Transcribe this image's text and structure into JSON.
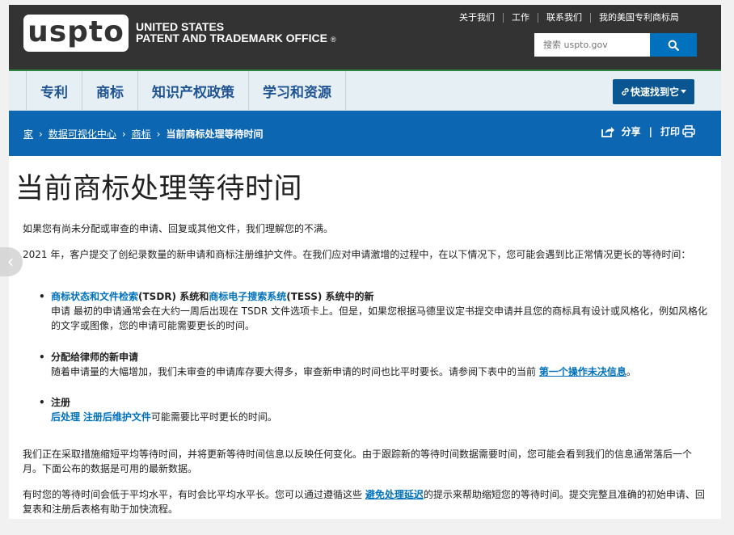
{
  "header": {
    "logo_text": "uspto",
    "agency_line1": "UNITED STATES",
    "agency_line2": "PATENT AND TRADEMARK OFFICE",
    "reg_mark": "®",
    "utility_links": [
      "关于我们",
      "工作",
      "联系我们",
      "我的美国专利商标局"
    ],
    "search_placeholder": "搜索 uspto.gov",
    "search_icon": "search-icon"
  },
  "nav": {
    "items": [
      "专利",
      "商标",
      "知识产权政策",
      "学习和资源"
    ],
    "quick_button": "快速找到它"
  },
  "breadcrumb": {
    "items": [
      "家",
      "数据可视化中心",
      "商标"
    ],
    "current": "当前商标处理等待时间",
    "share_label": "分享",
    "print_label": "打印"
  },
  "content": {
    "page_title": "当前商标处理等待时间",
    "intro": "如果您有尚未分配或审查的申请、回复或其他文件，我们理解您的不满。",
    "para2": "2021 年，客户提交了创纪录数量的新申请和商标注册维护文件。在我们应对申请激增的过程中，在以下情况下，您可能会遇到比正常情况更长的等待时间：",
    "bullet1": {
      "link1": "商标状态和文件检索",
      "text1": "(TSDR) 系统和",
      "link2": "商标电子搜索系统",
      "text2": "(TESS) 系统中的新",
      "body": "申请 最初的申请通常会在大约一周后出现在 TSDR 文件选项卡上。但是，如果您根据马德里议定书提交申请并且您的商标具有设计或风格化，例如风格化的文字或图像，您的申请可能需要更长的时间。"
    },
    "bullet2": {
      "heading": "分配给律师的新申请",
      "body": "随着申请量的大幅增加，我们未审查的申请库存要大得多，审查新申请的时间也比平时要长。请参阅下表中的当前",
      "link": "第一个操作未决信息",
      "end": "。"
    },
    "bullet3": {
      "heading": "注册",
      "link1": "后处理",
      "link2": "注册后维护文件",
      "body": "可能需要比平时更长的时间。"
    },
    "para3": "我们正在采取措施缩短平均等待时间，并将更新等待时间信息以反映任何变化。由于跟踪新的等待时间数据需要时间，您可能会看到我们的信息通常落后一个月。下面公布的数据是可用的最新数据。",
    "para4_start": "有时您的等待时间会低于平均水平，有时会比平均水平长。您可以通过遵循这些",
    "para4_link": "避免处理延迟",
    "para4_end": "的提示来帮助缩短您的等待时间。提交完整且准确的初始申请、回复表和注册后表格有助于加快流程。"
  },
  "colors": {
    "header_bg": "#333333",
    "nav_bg": "#e6eff4",
    "crumb_bg": "#0d66b2",
    "link": "#0071bc",
    "accent_green": "#2e8540"
  }
}
